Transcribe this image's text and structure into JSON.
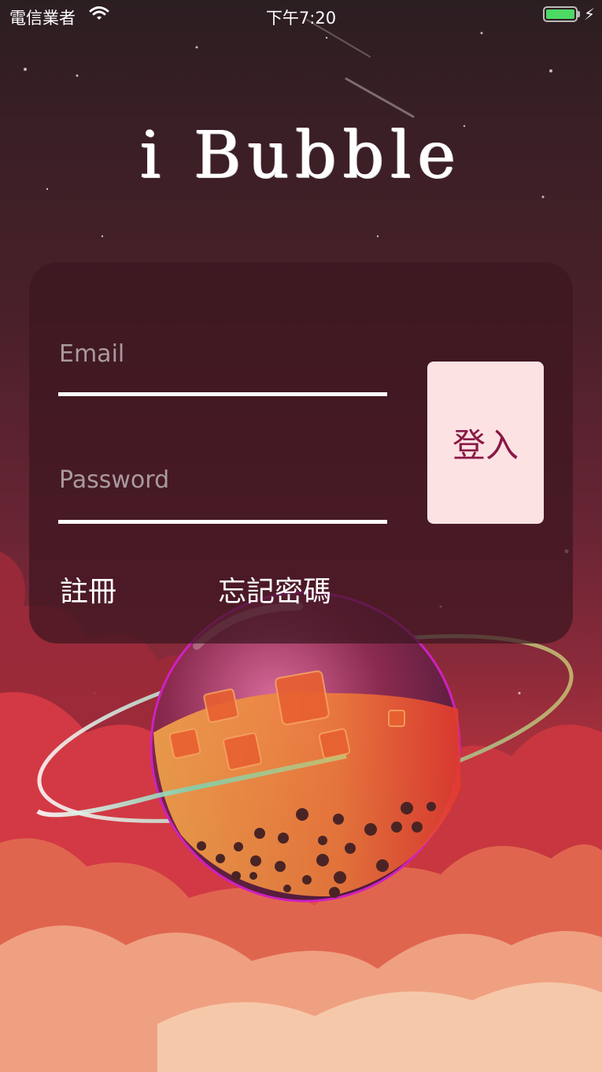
{
  "status_bar": {
    "carrier": "電信業者",
    "time": "下午7:20"
  },
  "app": {
    "title": "i Bubble"
  },
  "login_form": {
    "email_placeholder": "Email",
    "password_placeholder": "Password",
    "login_button": "登入",
    "register_link": "註冊",
    "forgot_password_link": "忘記密碼"
  },
  "icons": [
    "wifi-icon",
    "battery-icon",
    "charging-bolt-icon",
    "bubble-tea-planet-illustration"
  ],
  "colors": {
    "login_button_bg": "#fde2e4",
    "login_button_text": "#8a1845",
    "battery_fill": "#4cd964"
  }
}
